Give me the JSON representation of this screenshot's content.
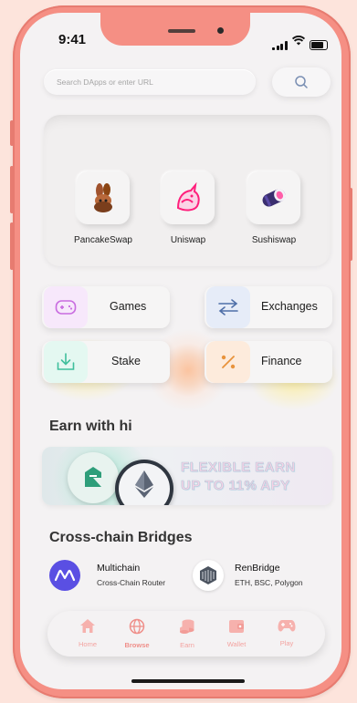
{
  "status": {
    "time": "9:41"
  },
  "search": {
    "placeholder": "Search DApps or enter URL"
  },
  "dexes": [
    {
      "label": "PancakeSwap",
      "icon": "pancakeswap-bunny-icon"
    },
    {
      "label": "Uniswap",
      "icon": "uniswap-unicorn-icon"
    },
    {
      "label": "Sushiswap",
      "icon": "sushi-icon"
    }
  ],
  "categories": [
    {
      "label": "Games",
      "icon": "gamepad-icon"
    },
    {
      "label": "Exchanges",
      "icon": "swap-arrows-icon"
    },
    {
      "label": "Stake",
      "icon": "download-tray-icon"
    },
    {
      "label": "Finance",
      "icon": "percent-icon"
    }
  ],
  "earn": {
    "title": "Earn with hi",
    "banner_line1": "FLEXIBLE EARN",
    "banner_line2": "UP TO 11% APY"
  },
  "bridges": {
    "title": "Cross-chain Bridges",
    "items": [
      {
        "name": "Multichain",
        "subtitle": "Cross-Chain Router",
        "icon": "multichain-icon"
      },
      {
        "name": "RenBridge",
        "subtitle": "ETH, BSC, Polygon",
        "icon": "renbridge-icon"
      }
    ]
  },
  "nav": [
    {
      "label": "Home",
      "icon": "home-icon",
      "active": false
    },
    {
      "label": "Browse",
      "icon": "globe-icon",
      "active": true
    },
    {
      "label": "Earn",
      "icon": "coins-icon",
      "active": false
    },
    {
      "label": "Wallet",
      "icon": "wallet-icon",
      "active": false
    },
    {
      "label": "Play",
      "icon": "gamepad-icon",
      "active": false
    }
  ],
  "colors": {
    "device": "#f58f84",
    "background": "#fde4dc",
    "nav_active": "#ef8f8a",
    "games_tile": "#f7e8fb",
    "exchanges_tile": "#e6ecf8",
    "stake_tile": "#e4f8f1",
    "finance_tile": "#fdebdc"
  }
}
